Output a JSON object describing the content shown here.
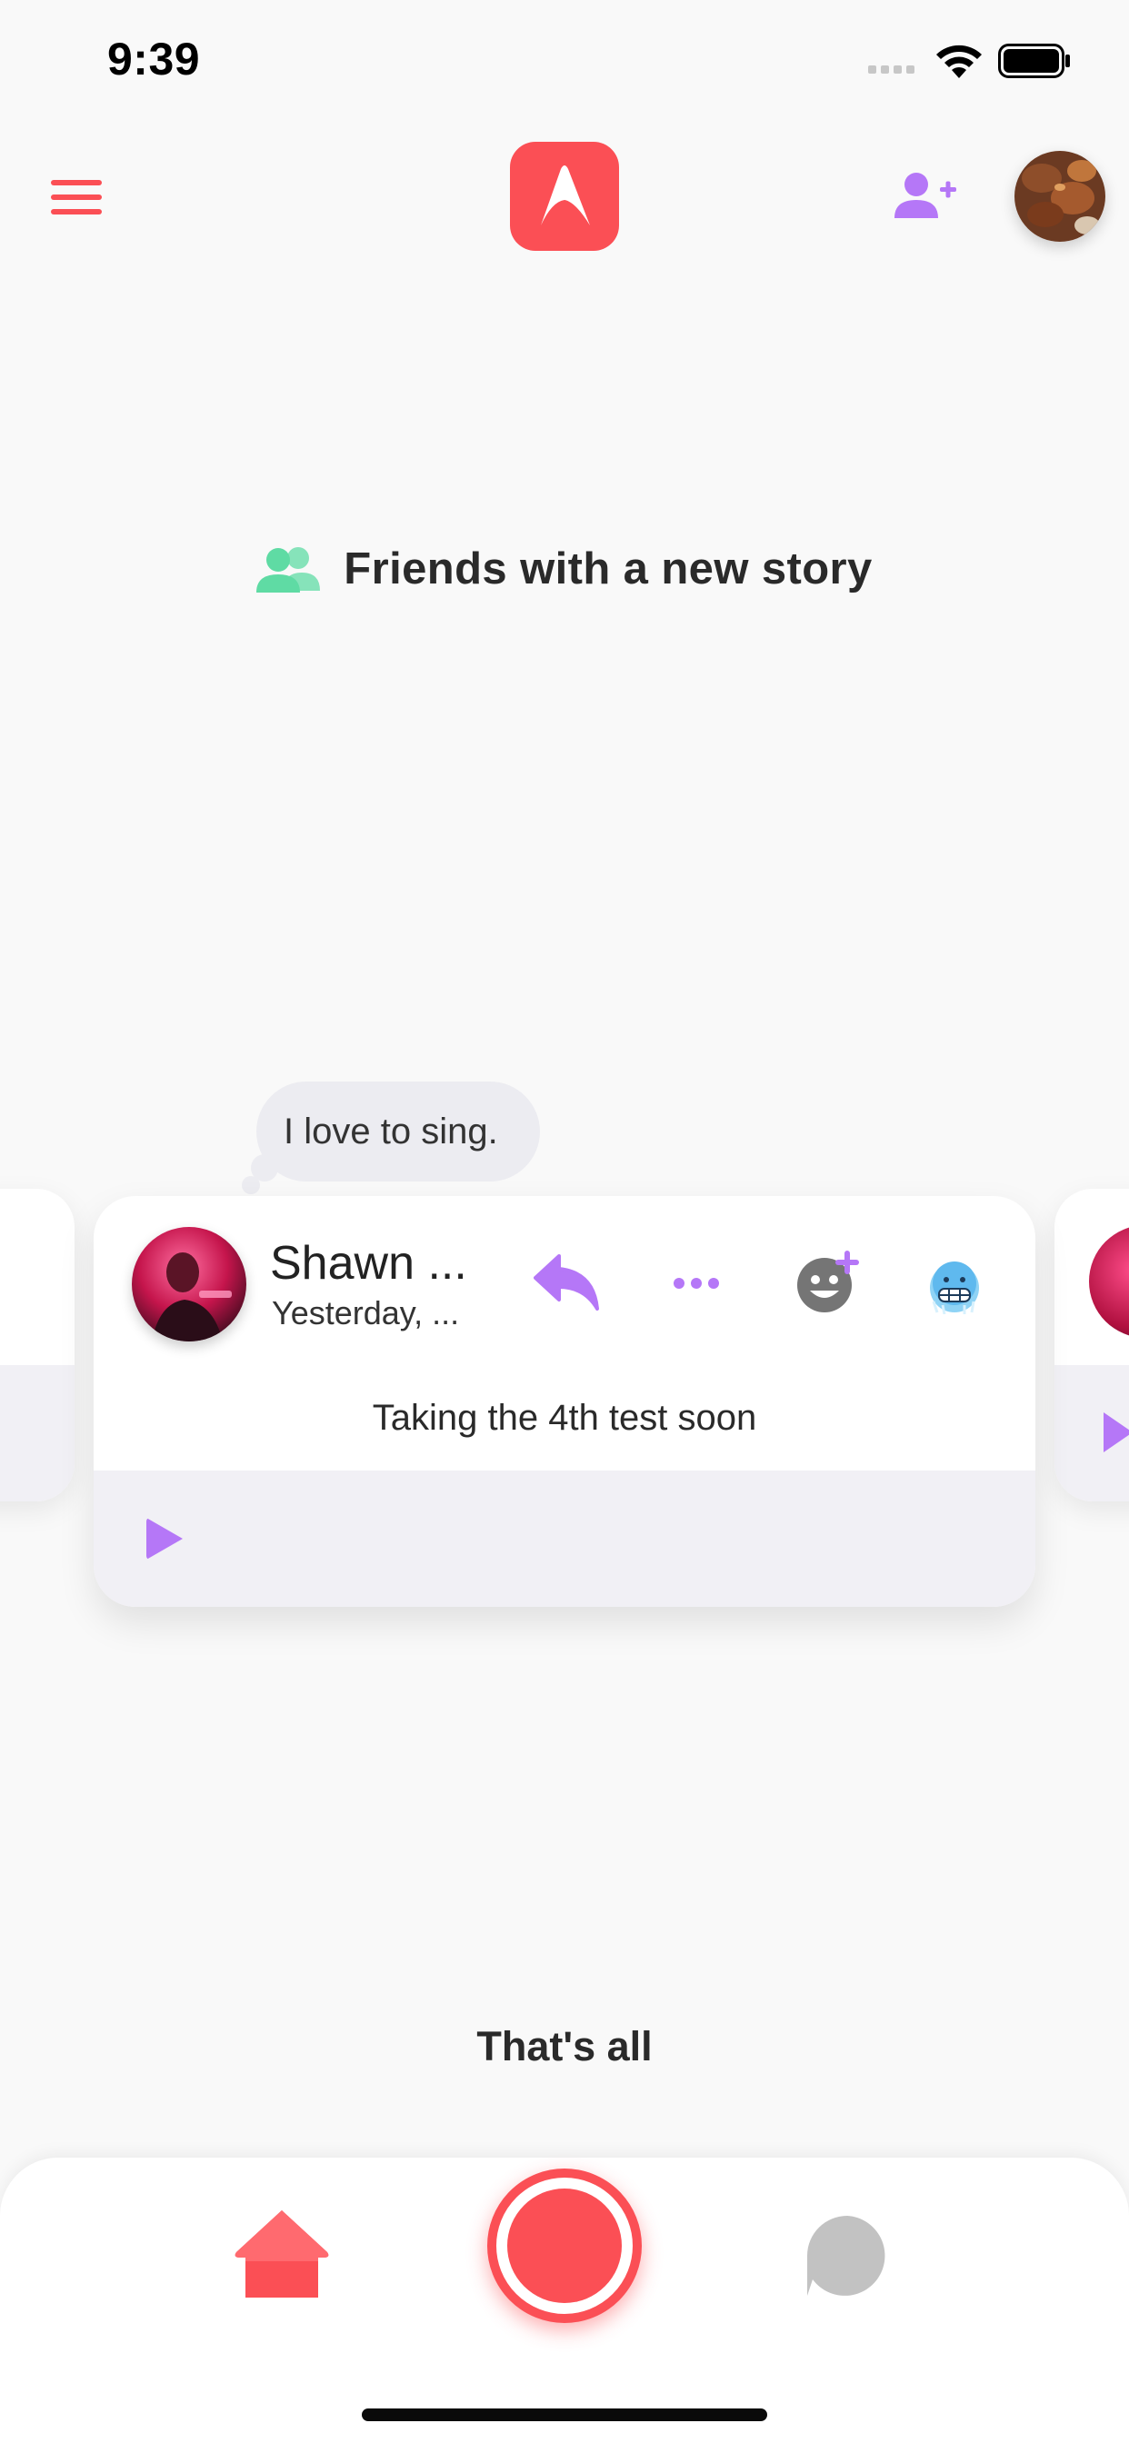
{
  "status_bar": {
    "time": "9:39"
  },
  "header": {
    "menu_icon": "hamburger-menu-icon",
    "logo_icon": "app-logo-icon",
    "add_friend_icon": "add-person-icon",
    "profile_avatar": "profile-photo"
  },
  "section": {
    "icon": "friends-group-icon",
    "title": "Friends with a new story"
  },
  "thought_bubble": {
    "text": "I love to sing."
  },
  "story": {
    "name": "Shawn ...",
    "time": "Yesterday, ...",
    "text": "Taking the 4th test soon",
    "actions": [
      "reply-icon",
      "more-icon",
      "add-reaction-icon",
      "grimacing-emoji-icon"
    ],
    "play_icon": "play-icon"
  },
  "footer": {
    "end_text": "That's all"
  },
  "bottom_nav": {
    "home_icon": "home-icon",
    "record_icon": "record-button",
    "chat_icon": "chat-bubble-icon"
  },
  "colors": {
    "accent_red": "#fb4f55",
    "accent_purple": "#b577f7",
    "friends_green": "#5fdba4",
    "background": "#f9f9f9",
    "player_bg": "#f1f0f5"
  }
}
